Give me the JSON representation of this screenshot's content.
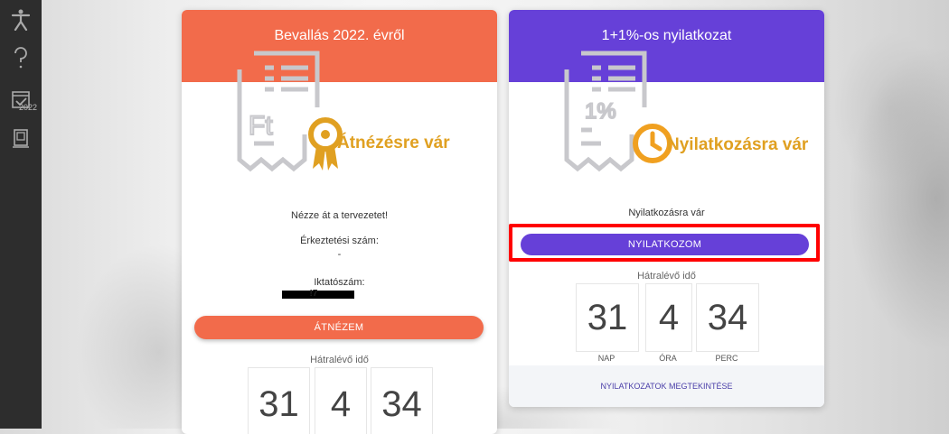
{
  "sidebar": {
    "items": [
      {
        "icon": "accessibility-icon"
      },
      {
        "icon": "help-icon"
      },
      {
        "icon": "calendar-check-icon",
        "year": "2022"
      },
      {
        "icon": "document-icon"
      }
    ]
  },
  "card_tax": {
    "title": "Bevallás 2022. évről",
    "icon": "tax-document-award-icon",
    "icon_text": "Ft",
    "status": "Átnézésre vár",
    "status_color": "#e0a021",
    "subtitle": "Nézze át a tervezetet!",
    "arrival_label": "Érkeztetési szám:",
    "arrival_value": "-",
    "filing_label": "Iktatószám:",
    "filing_value_suffix": "!7",
    "button": "ÁTNÉZEM",
    "remaining_label": "Hátralévő idő",
    "countdown": {
      "days": "31",
      "hours": "4",
      "minutes": "34"
    }
  },
  "card_declaration": {
    "title": "1+1%-os nyilatkozat",
    "icon": "document-clock-icon",
    "icon_text": "1%",
    "status": "Nyilatkozásra vár",
    "status_color": "#e0a021",
    "subtitle": "Nyilatkozásra vár",
    "button": "NYILATKOZOM",
    "remaining_label": "Hátralévő idő",
    "countdown": {
      "days": "31",
      "hours": "4",
      "minutes": "34"
    },
    "units": {
      "days": "NAP",
      "hours": "ÓRA",
      "minutes": "PERC"
    },
    "footer_link": "NYILATKOZATOK MEGTEKINTÉSE"
  },
  "colors": {
    "tax_header": "#f26b4b",
    "declaration_header": "#6640d8",
    "highlight": "#ff0000"
  }
}
